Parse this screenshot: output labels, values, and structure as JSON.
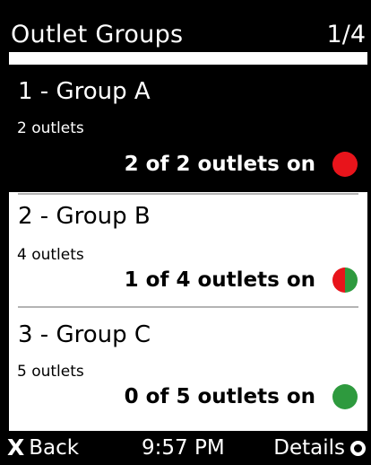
{
  "header": {
    "title": "Outlet Groups",
    "page_indicator": "1/4"
  },
  "groups": [
    {
      "name": "1 - Group A",
      "outlet_count": "2 outlets",
      "status": "2 of 2 outlets on",
      "status_icon": "red-dot-icon",
      "selected": true
    },
    {
      "name": "2 - Group B",
      "outlet_count": "4 outlets",
      "status": "1 of 4 outlets on",
      "status_icon": "red-green-split-dot-icon",
      "selected": false
    },
    {
      "name": "3 - Group C",
      "outlet_count": "5 outlets",
      "status": "0 of 5 outlets on",
      "status_icon": "green-dot-icon",
      "selected": false
    }
  ],
  "footer": {
    "back_icon": "X",
    "back_label": "Back",
    "time": "9:57 PM",
    "details_label": "Details",
    "details_icon": "ring-icon"
  },
  "colors": {
    "background": "#000000",
    "list_background": "#ffffff",
    "status_red": "#e8141b",
    "status_green": "#2e9a3e",
    "divider": "#b4b4b4"
  }
}
